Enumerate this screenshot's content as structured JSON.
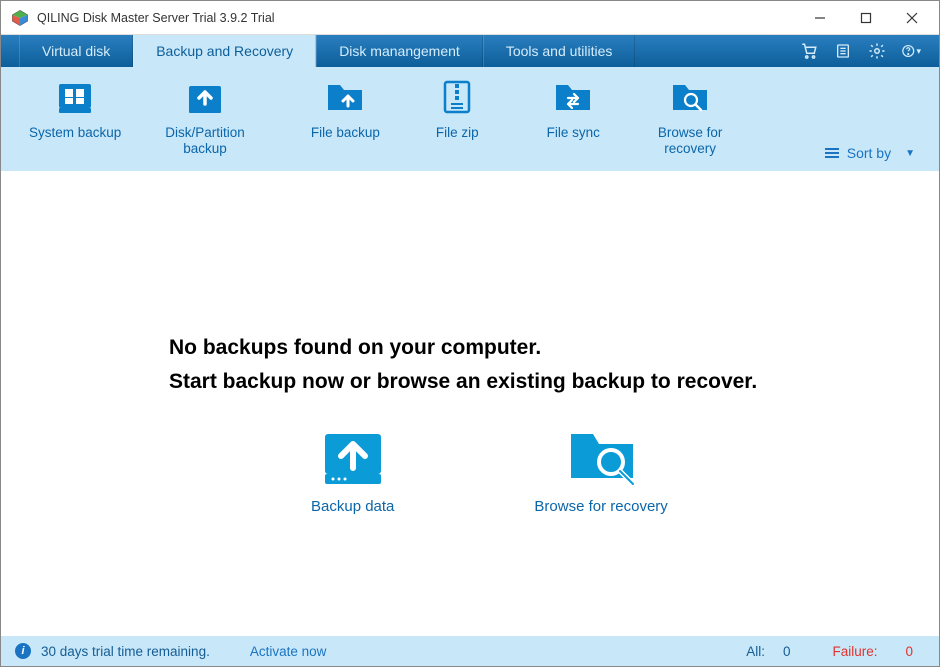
{
  "window": {
    "title": "QILING Disk Master Server Trial 3.9.2 Trial"
  },
  "tabs": [
    {
      "label": "Virtual disk",
      "active": false
    },
    {
      "label": "Backup and Recovery",
      "active": true
    },
    {
      "label": "Disk manangement",
      "active": false
    },
    {
      "label": "Tools and utilities",
      "active": false
    }
  ],
  "toolbar": {
    "items": [
      {
        "label": "System backup"
      },
      {
        "label": "Disk/Partition\nbackup"
      },
      {
        "label": "File backup"
      },
      {
        "label": "File zip"
      },
      {
        "label": "File sync"
      },
      {
        "label": "Browse for\nrecovery"
      }
    ],
    "sortby": "Sort by"
  },
  "main": {
    "heading1": "No backups found on your computer.",
    "heading2": "Start backup now or browse an existing backup to recover.",
    "actions": [
      {
        "label": "Backup data"
      },
      {
        "label": "Browse for recovery"
      }
    ]
  },
  "status": {
    "trial_msg": "30 days trial time remaining.",
    "activate": "Activate now",
    "all_label": "All:",
    "all_value": "0",
    "fail_label": "Failure:",
    "fail_value": "0"
  }
}
